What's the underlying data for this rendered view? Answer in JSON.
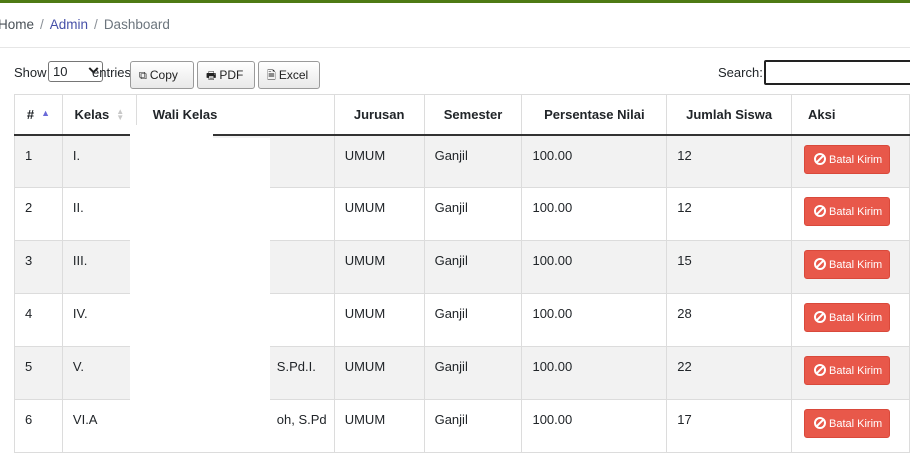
{
  "breadcrumb": {
    "home": "Home",
    "admin": "Admin",
    "current": "Dashboard",
    "separator": "/"
  },
  "controls": {
    "show_label": "Show",
    "entries_value": "10",
    "entries_label": "entries",
    "copy_label": "Copy",
    "pdf_label": "PDF",
    "excel_label": "Excel",
    "search_label": "Search:",
    "search_value": ""
  },
  "table": {
    "headers": [
      "#",
      "Kelas",
      "Wali Kelas",
      "Jurusan",
      "Semester",
      "Persentase Nilai",
      "Jumlah Siswa",
      "Aksi"
    ],
    "action_label": "Batal Kirim",
    "rows": [
      {
        "no": "1",
        "kelas": "I.",
        "wali": "",
        "jurusan": "UMUM",
        "semester": "Ganjil",
        "persentase": "100.00",
        "jumlah": "12"
      },
      {
        "no": "2",
        "kelas": "II.",
        "wali": "",
        "jurusan": "UMUM",
        "semester": "Ganjil",
        "persentase": "100.00",
        "jumlah": "12"
      },
      {
        "no": "3",
        "kelas": "III.",
        "wali": "",
        "jurusan": "UMUM",
        "semester": "Ganjil",
        "persentase": "100.00",
        "jumlah": "15"
      },
      {
        "no": "4",
        "kelas": "IV.",
        "wali": "",
        "jurusan": "UMUM",
        "semester": "Ganjil",
        "persentase": "100.00",
        "jumlah": "28"
      },
      {
        "no": "5",
        "kelas": "V.",
        "wali": "S.Pd.I.",
        "jurusan": "UMUM",
        "semester": "Ganjil",
        "persentase": "100.00",
        "jumlah": "22"
      },
      {
        "no": "6",
        "kelas": "VI.A",
        "wali": "oh, S.Pd",
        "jurusan": "UMUM",
        "semester": "Ganjil",
        "persentase": "100.00",
        "jumlah": "17"
      }
    ]
  },
  "colors": {
    "accent": "#4e7a14",
    "danger": "#e8584a",
    "link": "#4650a8"
  }
}
